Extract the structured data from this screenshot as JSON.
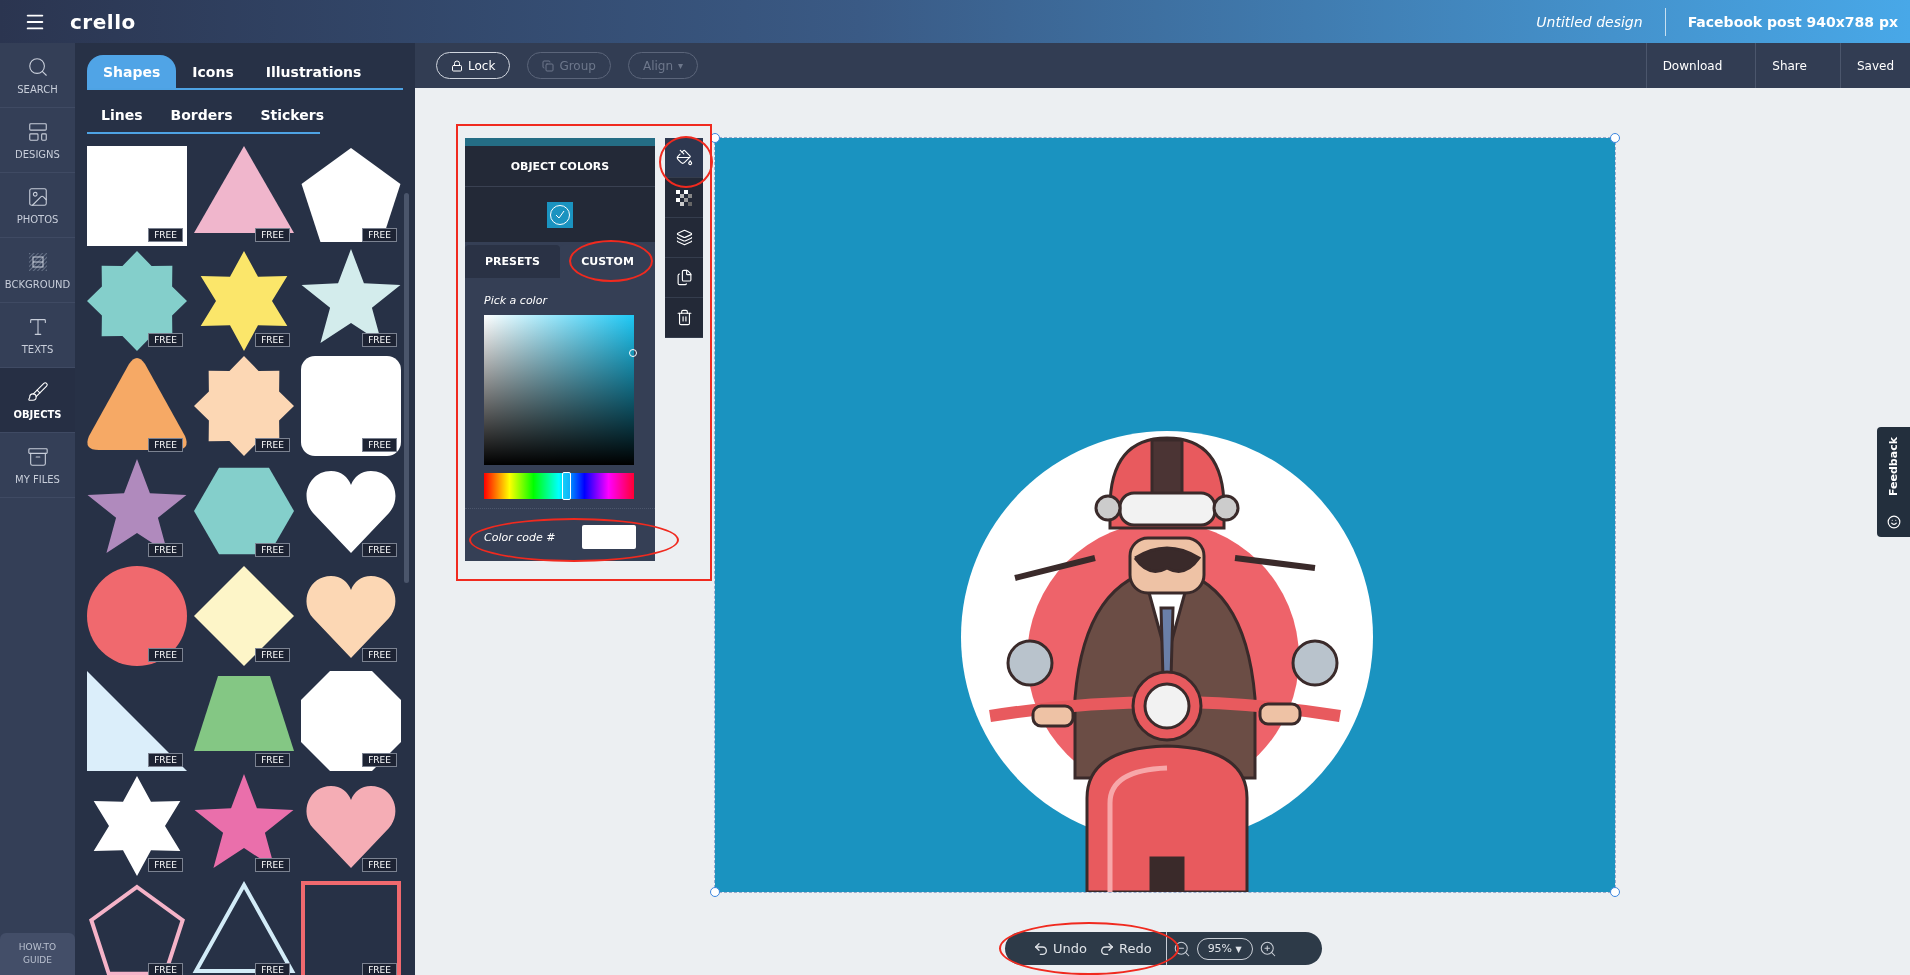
{
  "app": {
    "logo": "crello",
    "design_title": "Untitled design",
    "format": "Facebook post 940x788 px"
  },
  "nav": [
    {
      "label": "SEARCH",
      "selected": false
    },
    {
      "label": "DESIGNS",
      "selected": false
    },
    {
      "label": "PHOTOS",
      "selected": false
    },
    {
      "label": "BCKGROUND",
      "selected": false
    },
    {
      "label": "TEXTS",
      "selected": false
    },
    {
      "label": "OBJECTS",
      "selected": true
    },
    {
      "label": "MY FILES",
      "selected": false
    }
  ],
  "guide": "HOW-TO GUIDE",
  "tabs": [
    {
      "label": "Shapes",
      "selected": true
    },
    {
      "label": "Icons",
      "selected": false
    },
    {
      "label": "Illustrations",
      "selected": false
    }
  ],
  "subtabs": [
    {
      "label": "Lines"
    },
    {
      "label": "Borders"
    },
    {
      "label": "Stickers"
    }
  ],
  "shapes": [
    {
      "kind": "square",
      "color": "#ffffff",
      "badge": "FREE"
    },
    {
      "kind": "triangle",
      "color": "#f0b6cc",
      "badge": "FREE"
    },
    {
      "kind": "pentagon",
      "color": "#ffffff",
      "badge": "FREE"
    },
    {
      "kind": "octastar",
      "color": "#84cfcb",
      "badge": "FREE"
    },
    {
      "kind": "hexastar",
      "color": "#fbe66a",
      "badge": "FREE"
    },
    {
      "kind": "star",
      "color": "#d3ecec",
      "badge": "FREE"
    },
    {
      "kind": "roundtriangle",
      "color": "#f6a965",
      "badge": "FREE"
    },
    {
      "kind": "octastar",
      "color": "#fcd7b4",
      "badge": "FREE"
    },
    {
      "kind": "roundsquare",
      "color": "#ffffff",
      "badge": "FREE"
    },
    {
      "kind": "star",
      "color": "#b08abd",
      "badge": "FREE"
    },
    {
      "kind": "hexagon",
      "color": "#84cfcb",
      "badge": "FREE"
    },
    {
      "kind": "heart",
      "color": "#ffffff",
      "badge": "FREE"
    },
    {
      "kind": "circle",
      "color": "#f0696e",
      "badge": "FREE"
    },
    {
      "kind": "diamond",
      "color": "#fdf5c8",
      "badge": "FREE"
    },
    {
      "kind": "heart",
      "color": "#fcd7b4",
      "badge": "FREE"
    },
    {
      "kind": "righttriangle",
      "color": "#dbeefa",
      "badge": "FREE"
    },
    {
      "kind": "trapezoid",
      "color": "#84c784",
      "badge": "FREE"
    },
    {
      "kind": "octagon",
      "color": "#ffffff",
      "badge": "FREE"
    },
    {
      "kind": "hexastar",
      "color": "#ffffff",
      "badge": "FREE"
    },
    {
      "kind": "star",
      "color": "#ea6fab",
      "badge": "FREE"
    },
    {
      "kind": "heart",
      "color": "#f5adb5",
      "badge": "FREE"
    },
    {
      "kind": "pentagonoutline",
      "color": "#f5b3c8",
      "badge": "FREE"
    },
    {
      "kind": "triangleoutline",
      "color": "#d3ecf8",
      "badge": "FREE"
    },
    {
      "kind": "squareoutline",
      "color": "#f0696e",
      "badge": "FREE"
    }
  ],
  "toolbar": {
    "buttons": [
      {
        "label": "Lock",
        "disabled": false
      },
      {
        "label": "Group",
        "disabled": true
      },
      {
        "label": "Align",
        "caret": "▾",
        "disabled": true
      }
    ],
    "actions": [
      "Download",
      "Share",
      "Saved"
    ]
  },
  "color_panel": {
    "title": "OBJECT COLORS",
    "swatches": [
      {
        "color": "#1a93c0",
        "selected": true
      }
    ],
    "tabs": [
      {
        "label": "PRESETS",
        "selected": false
      },
      {
        "label": "CUSTOM",
        "selected": true
      }
    ],
    "pick_label": "Pick a color",
    "hue": {
      "level": 0.54
    },
    "code_label": "Color code #"
  },
  "side_tools": [
    {
      "selected": true
    },
    {
      "selected": false
    },
    {
      "selected": false
    },
    {
      "selected": false
    },
    {
      "selected": false
    }
  ],
  "history": {
    "undo": "Undo",
    "redo": "Redo",
    "zoom": "95%",
    "zoom_caret": "▼"
  },
  "feedback": "Feedback"
}
